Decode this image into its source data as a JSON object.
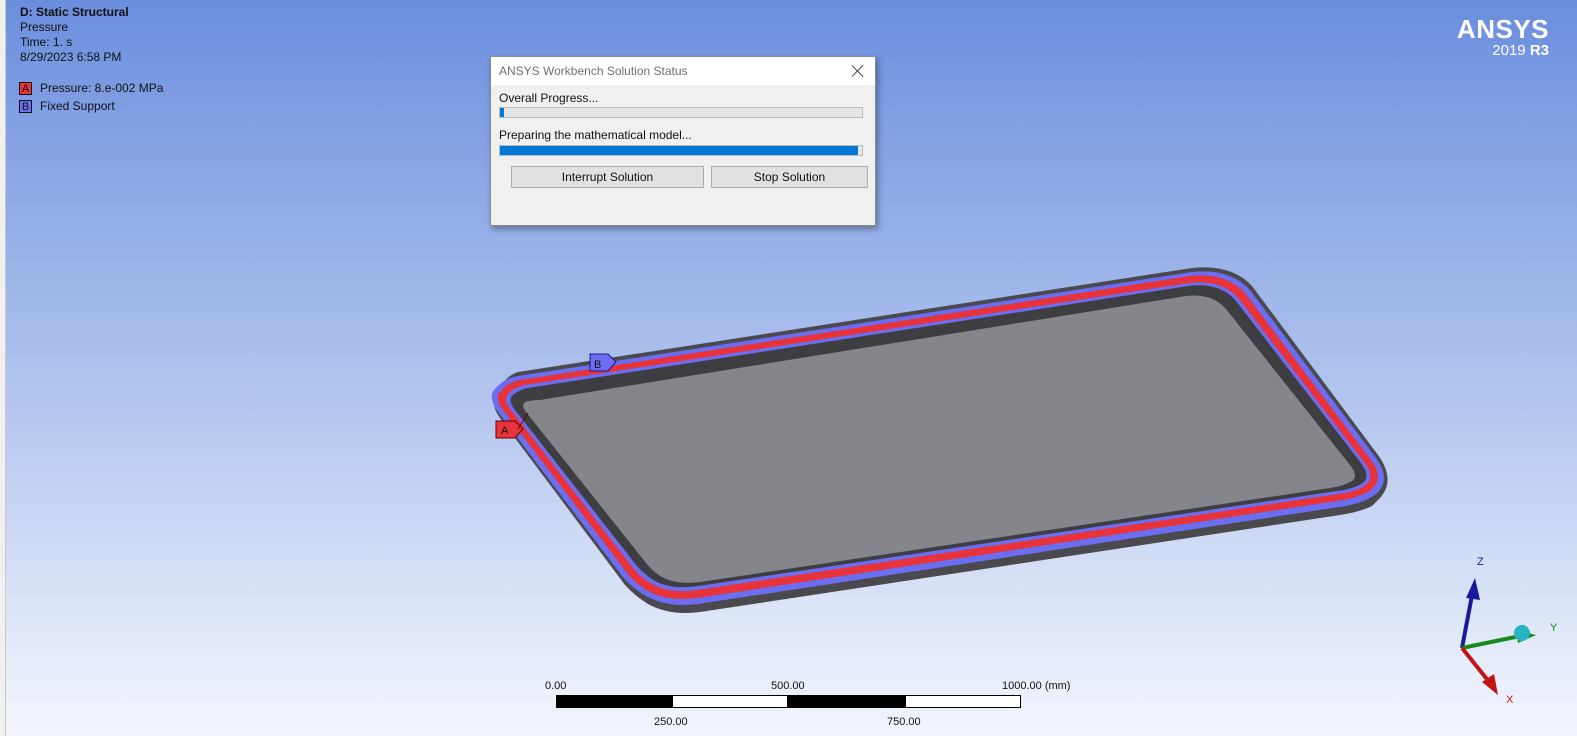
{
  "info": {
    "analysis_title": "D: Static Structural",
    "object_name": "Pressure",
    "time": "Time: 1. s",
    "date": "8/29/2023 6:58 PM"
  },
  "legend": [
    {
      "letter": "A",
      "label": "Pressure: 8.e-002 MPa",
      "color": "#e8333a"
    },
    {
      "letter": "B",
      "label": "Fixed Support",
      "color": "#6b6ef0"
    }
  ],
  "logo": {
    "name": "ANSYS",
    "version": "2019",
    "release": "R3"
  },
  "dialog": {
    "title": "ANSYS Workbench Solution Status",
    "overall_label": "Overall Progress...",
    "overall_progress": 0.01,
    "step_label": "Preparing the mathematical model...",
    "step_progress": 0.99,
    "interrupt_label": "Interrupt Solution",
    "stop_label": "Stop Solution"
  },
  "model_tags": {
    "a": "A",
    "b": "B"
  },
  "scale": {
    "t0": "0.00",
    "t500": "500.00",
    "t1000": "1000.00 (mm)",
    "t250": "250.00",
    "t750": "750.00"
  },
  "triad": {
    "x": "X",
    "y": "Y",
    "z": "Z"
  },
  "colors": {
    "accent_progress": "#0078d7",
    "pressure": "#e8333a",
    "support": "#6b6ef0",
    "part": "#85868c"
  }
}
